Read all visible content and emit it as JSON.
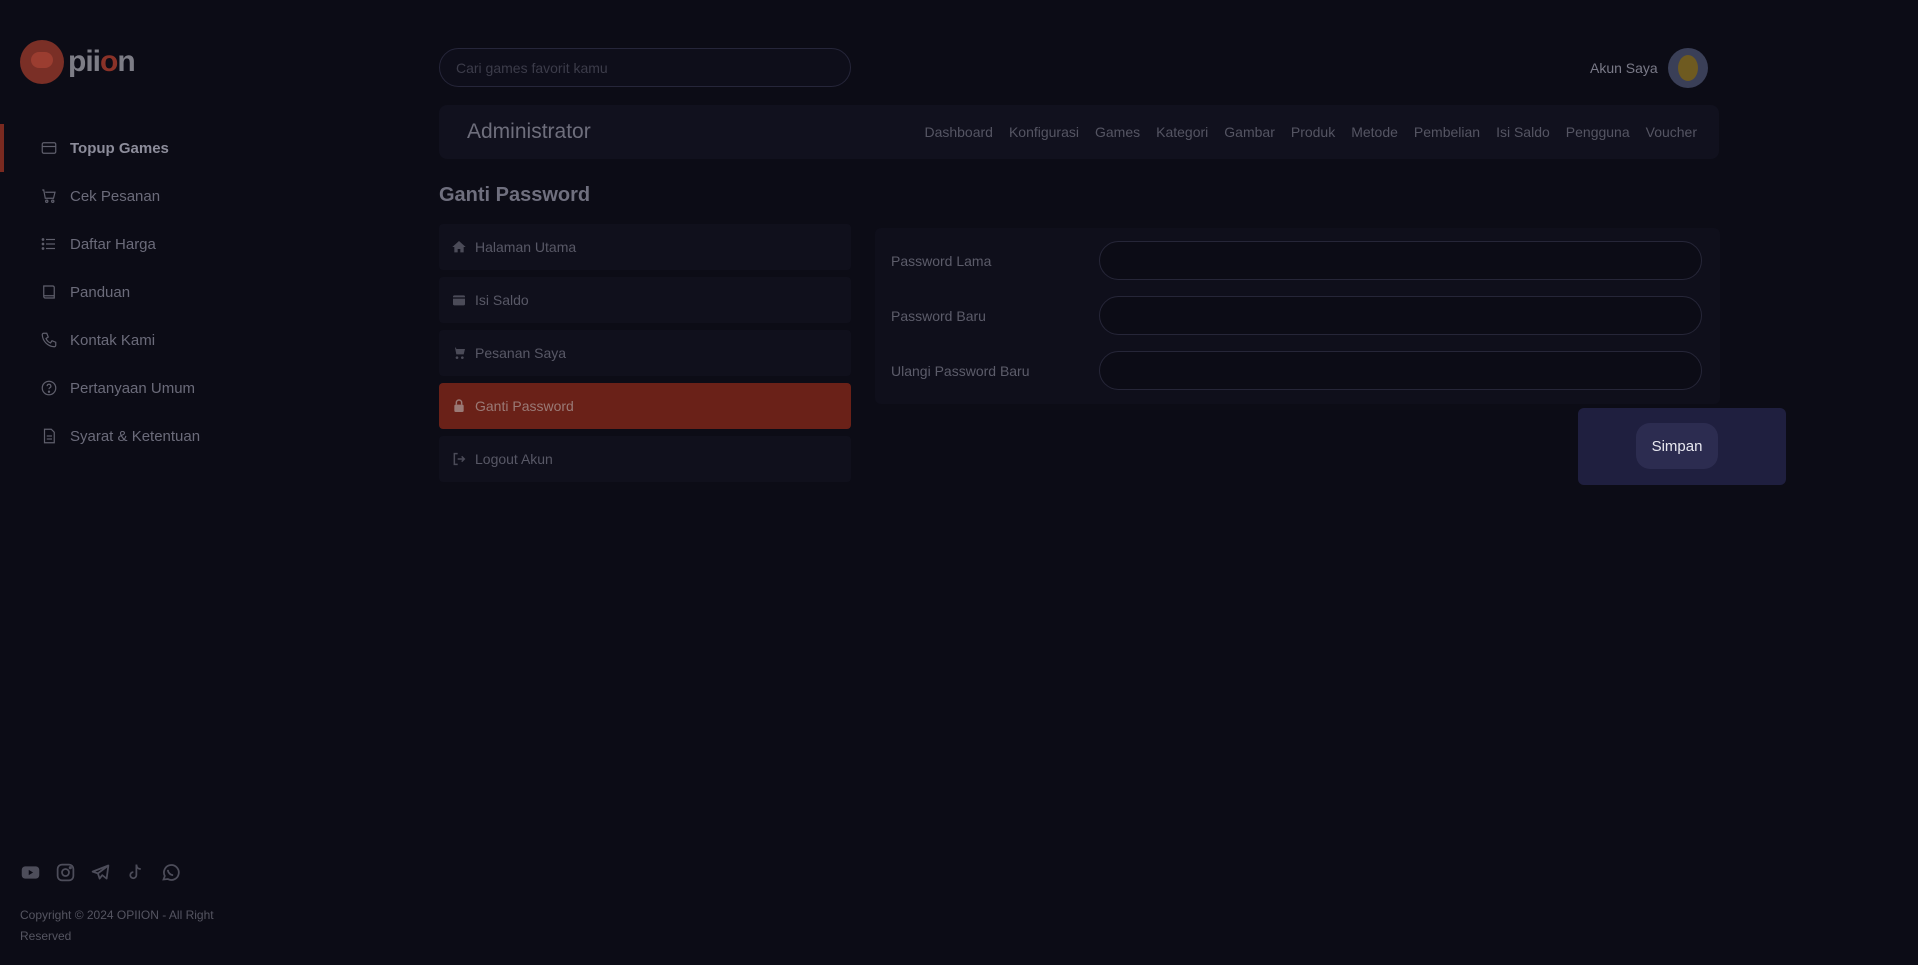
{
  "brand": {
    "name_prefix": "pii",
    "name_o": "o",
    "name_suffix": "n"
  },
  "sidebar": {
    "items": [
      {
        "label": "Topup Games",
        "icon": "credit-card-icon",
        "active": true
      },
      {
        "label": "Cek Pesanan",
        "icon": "cart-icon",
        "active": false
      },
      {
        "label": "Daftar Harga",
        "icon": "list-icon",
        "active": false
      },
      {
        "label": "Panduan",
        "icon": "book-icon",
        "active": false
      },
      {
        "label": "Kontak Kami",
        "icon": "phone-icon",
        "active": false
      },
      {
        "label": "Pertanyaan Umum",
        "icon": "help-circle-icon",
        "active": false
      },
      {
        "label": "Syarat & Ketentuan",
        "icon": "document-icon",
        "active": false
      }
    ],
    "socials": [
      "youtube-icon",
      "instagram-icon",
      "telegram-icon",
      "tiktok-icon",
      "whatsapp-icon"
    ],
    "copyright": "Copyright © 2024 OPIION - All Right Reserved"
  },
  "header": {
    "search_placeholder": "Cari games favorit kamu",
    "account_label": "Akun Saya"
  },
  "admin": {
    "title": "Administrator",
    "menu": [
      "Dashboard",
      "Konfigurasi",
      "Games",
      "Kategori",
      "Gambar",
      "Produk",
      "Metode",
      "Pembelian",
      "Isi Saldo",
      "Pengguna",
      "Voucher"
    ]
  },
  "page": {
    "title": "Ganti Password"
  },
  "account_menu": {
    "items": [
      {
        "label": "Halaman Utama",
        "icon": "home-icon",
        "active": false
      },
      {
        "label": "Isi Saldo",
        "icon": "wallet-icon",
        "active": false
      },
      {
        "label": "Pesanan Saya",
        "icon": "cart-icon",
        "active": false
      },
      {
        "label": "Ganti Password",
        "icon": "lock-icon",
        "active": true
      },
      {
        "label": "Logout Akun",
        "icon": "logout-icon",
        "active": false
      }
    ]
  },
  "form": {
    "old_password_label": "Password Lama",
    "new_password_label": "Password Baru",
    "repeat_password_label": "Ulangi Password Baru",
    "old_password_value": "",
    "new_password_value": "",
    "repeat_password_value": "",
    "submit_label": "Simpan"
  },
  "colors": {
    "background": "#0c0c16",
    "accent": "#6a2118",
    "save_panel": "#1f1f3f"
  }
}
